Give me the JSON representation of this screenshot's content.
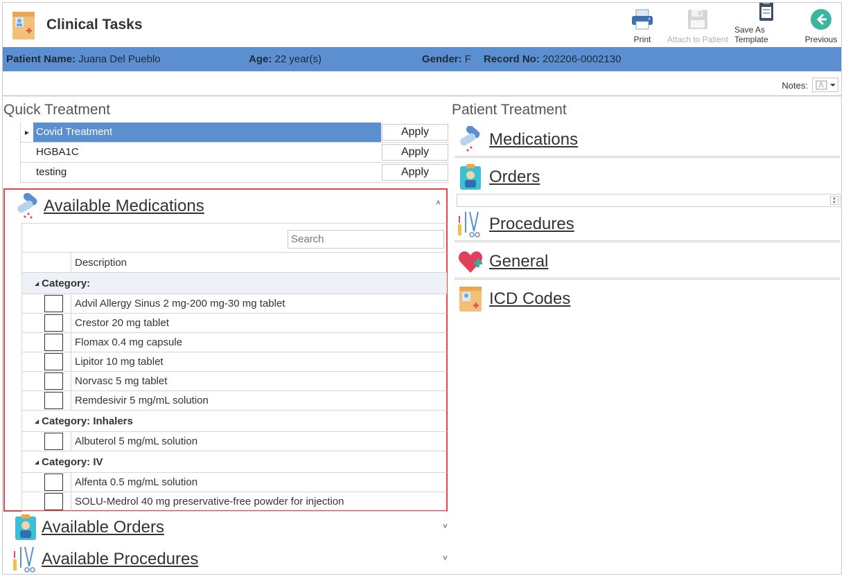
{
  "app": {
    "title": "Clinical Tasks"
  },
  "toolbar": {
    "print_label": "Print",
    "attach_label": "Attach to Patient",
    "template_label": "Save As Template",
    "previous_label": "Previous"
  },
  "patient": {
    "name_label": "Patient Name:",
    "name_value": "Juana Del Pueblo",
    "age_label": "Age:",
    "age_value": "22 year(s)",
    "gender_label": "Gender:",
    "gender_value": "F",
    "record_label": "Record No:",
    "record_value": "202206-0002130"
  },
  "notes": {
    "label": "Notes:"
  },
  "quick_treatment": {
    "title": "Quick Treatment",
    "apply_label": "Apply",
    "rows": [
      {
        "name": "Covid Treatment"
      },
      {
        "name": "HGBA1C"
      },
      {
        "name": "testing"
      }
    ]
  },
  "medications_panel": {
    "title": "Available Medications",
    "search_placeholder": "Search",
    "column_description": "Description",
    "groups": [
      {
        "label": "Category:",
        "items": [
          "Advil Allergy Sinus 2 mg-200 mg-30 mg tablet",
          "Crestor 20 mg tablet",
          "Flomax 0.4 mg capsule",
          "Lipitor 10 mg tablet",
          "Norvasc 5 mg tablet",
          "Remdesivir 5 mg/mL solution"
        ]
      },
      {
        "label": "Category: Inhalers",
        "items": [
          "Albuterol 5 mg/mL solution"
        ]
      },
      {
        "label": "Category: IV",
        "items": [
          "Alfenta 0.5 mg/mL solution",
          "SOLU-Medrol 40 mg preservative-free powder for injection"
        ]
      }
    ]
  },
  "orders_panel": {
    "title": "Available Orders"
  },
  "procedures_panel": {
    "title": "Available Procedures"
  },
  "patient_treatment": {
    "title": "Patient Treatment",
    "items": [
      "Medications",
      "Orders",
      "Procedures",
      "General",
      "ICD Codes"
    ]
  },
  "colors": {
    "accent": "#5b8fcf",
    "highlight_border": "#e8454b"
  }
}
